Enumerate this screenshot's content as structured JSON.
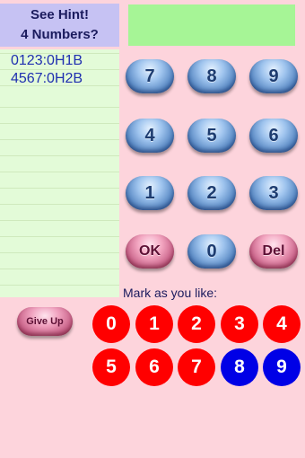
{
  "hint": {
    "line1": "See Hint!",
    "line2": "4 Numbers?"
  },
  "display": {
    "value": ""
  },
  "history": [
    "0123:0H1B",
    "4567:0H2B"
  ],
  "keypad": {
    "k7": "7",
    "k8": "8",
    "k9": "9",
    "k4": "4",
    "k5": "5",
    "k6": "6",
    "k1": "1",
    "k2": "2",
    "k3": "3",
    "ok": "OK",
    "k0": "0",
    "del": "Del"
  },
  "give_up_label": "Give Up",
  "mark_label": "Mark as you like:",
  "marks": {
    "m0": "0",
    "m1": "1",
    "m2": "2",
    "m3": "3",
    "m4": "4",
    "m5": "5",
    "m6": "6",
    "m7": "7",
    "m8": "8",
    "m9": "9"
  },
  "colors": {
    "mark_red": "#ff0000",
    "mark_blue": "#0000e6",
    "background": "#fdd4dc",
    "display_green": "#a6f596",
    "hint_lavender": "#c6c2f3"
  },
  "mark_states": {
    "red": [
      "0",
      "1",
      "2",
      "3",
      "4",
      "5",
      "6",
      "7"
    ],
    "blue": [
      "8",
      "9"
    ]
  }
}
